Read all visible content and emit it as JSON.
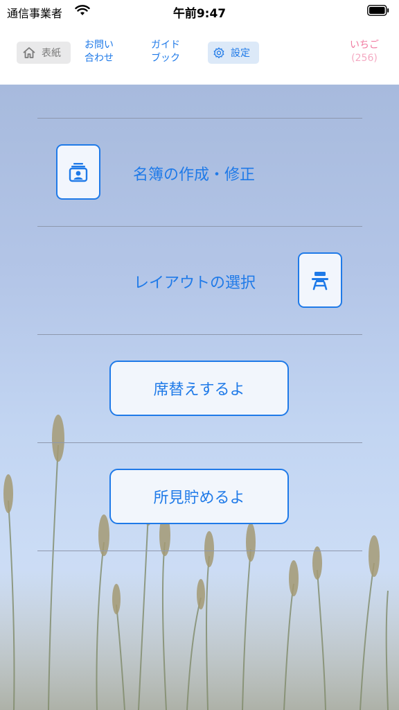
{
  "status_bar": {
    "carrier": "通信事業者",
    "time": "午前9:47"
  },
  "nav": {
    "home_label": "表紙",
    "contact_line1": "お問い",
    "contact_line2": "合わせ",
    "guide_line1": "ガイド",
    "guide_line2": "ブック",
    "settings_label": "設定",
    "user_name": "いちご",
    "user_count": "(256)"
  },
  "menu": {
    "roster_label": "名簿の作成・修正",
    "layout_label": "レイアウトの選択",
    "seat_change_button": "席替えするよ",
    "notes_button": "所見貯めるよ"
  },
  "colors": {
    "accent": "#1f7ae8",
    "user": "#f07aa0"
  },
  "icons": {
    "home": "house-icon",
    "settings": "gear-icon",
    "roster": "contact-card-stack-icon",
    "layout": "school-desk-icon"
  }
}
